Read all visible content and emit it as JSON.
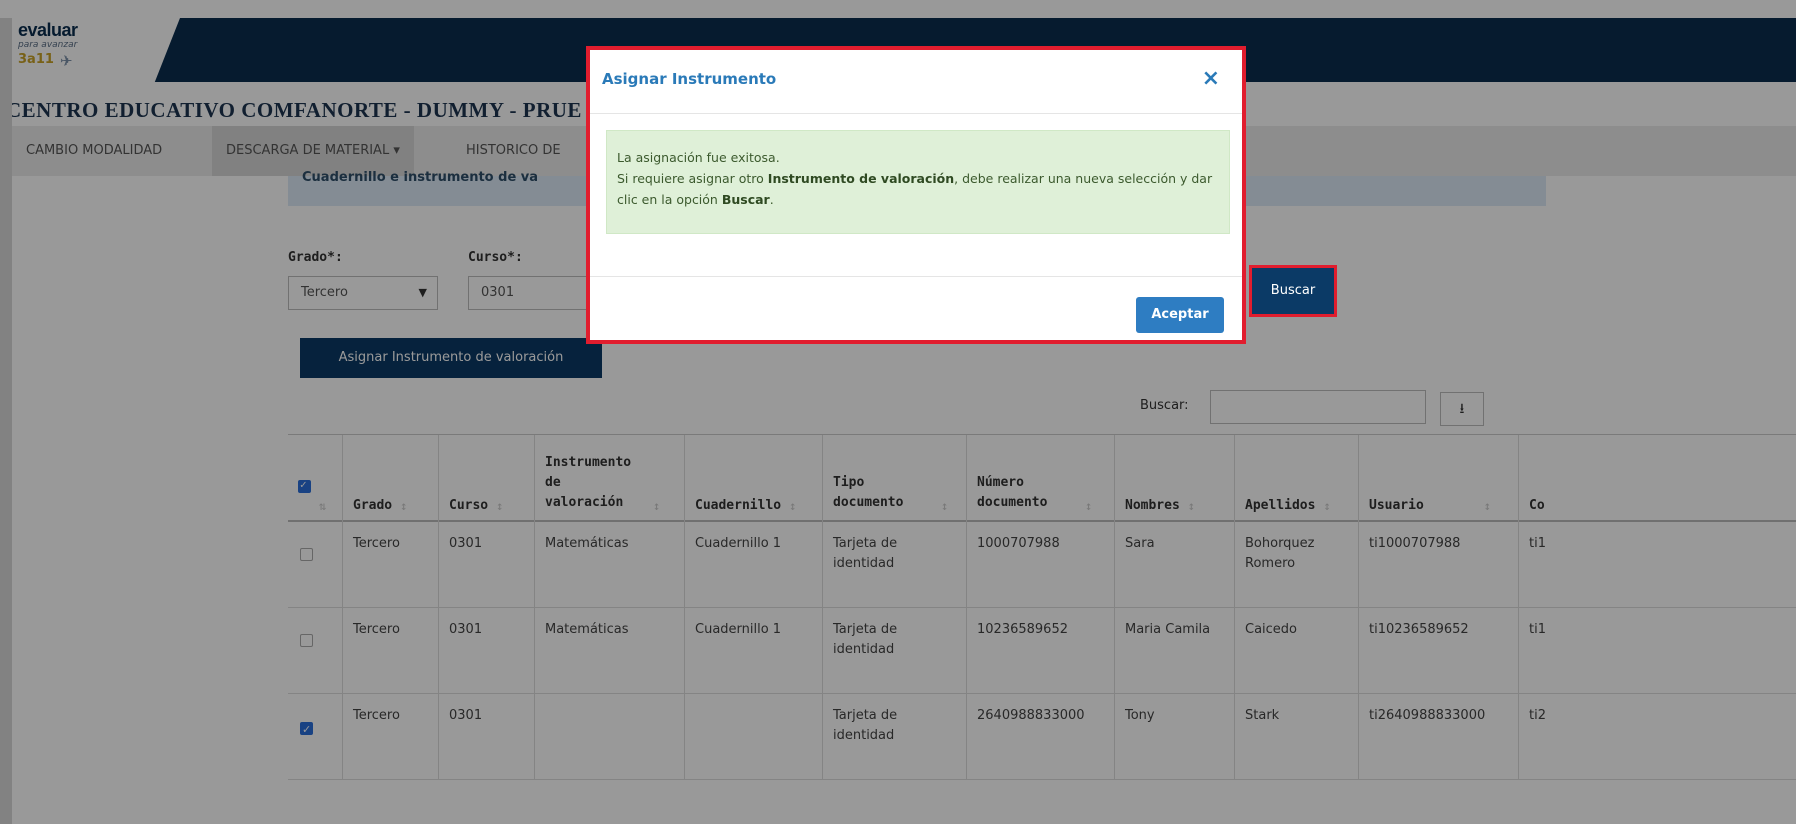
{
  "header": {
    "logo_text": "evaluar",
    "logo_sub": "para avanzar",
    "logo_badge": "3a11"
  },
  "school_title": "CENTRO EDUCATIVO COMFANORTE - DUMMY - PRUE",
  "nav": {
    "items": [
      {
        "label": "CAMBIO MODALIDAD"
      },
      {
        "label": "DESCARGA DE MATERIAL ▾"
      },
      {
        "label": "HISTORICO DE"
      }
    ]
  },
  "info_strip": "Cuadernillo e instrumento de va",
  "filters": {
    "grado_label": "Grado*:",
    "grado_value": "Tercero",
    "curso_label": "Curso*:",
    "curso_value": "0301",
    "buscar_button": "Buscar"
  },
  "assign_button": "Asignar Instrumento de valoración",
  "search": {
    "label": "Buscar:",
    "value": "",
    "download_icon": "⭳"
  },
  "table": {
    "columns": [
      {
        "label": "",
        "sort": "⇅"
      },
      {
        "label": "Grado",
        "sort": "↕"
      },
      {
        "label": "Curso",
        "sort": "↕"
      },
      {
        "label": "Instrumento de valoración",
        "sort": "↕"
      },
      {
        "label": "Cuadernillo",
        "sort": "↕"
      },
      {
        "label": "Tipo documento",
        "sort": "↕"
      },
      {
        "label": "Número documento",
        "sort": "↕"
      },
      {
        "label": "Nombres",
        "sort": "↕"
      },
      {
        "label": "Apellidos",
        "sort": "↕"
      },
      {
        "label": "Usuario",
        "sort": "↕"
      },
      {
        "label": "Co",
        "sort": ""
      }
    ],
    "rows": [
      {
        "checked": false,
        "cells": [
          "Tercero",
          "0301",
          "Matemáticas",
          "Cuadernillo 1",
          "Tarjeta de identidad",
          "1000707988",
          "Sara",
          "Bohorquez Romero",
          "ti1000707988",
          "ti1"
        ]
      },
      {
        "checked": false,
        "cells": [
          "Tercero",
          "0301",
          "Matemáticas",
          "Cuadernillo 1",
          "Tarjeta de identidad",
          "10236589652",
          "Maria Camila",
          "Caicedo",
          "ti10236589652",
          "ti1"
        ]
      },
      {
        "checked": true,
        "cells": [
          "Tercero",
          "0301",
          "",
          "",
          "Tarjeta de identidad",
          "2640988833000",
          "Tony",
          "Stark",
          "ti2640988833000",
          "ti2"
        ]
      }
    ]
  },
  "modal": {
    "title": "Asignar Instrumento",
    "close": "×",
    "line1": "La asignación fue exitosa.",
    "line2_a": "Si requiere asignar otro ",
    "line2_b": "Instrumento de valoración",
    "line2_c": ", debe realizar una nueva selección y dar clic en la opción ",
    "line2_d": "Buscar",
    "line2_e": ".",
    "accept": "Aceptar"
  },
  "colors": {
    "header_bg": "#0b2e4f",
    "primary": "#2e7dc2",
    "highlight": "#e11d2e",
    "success_bg": "#dff0d8"
  }
}
